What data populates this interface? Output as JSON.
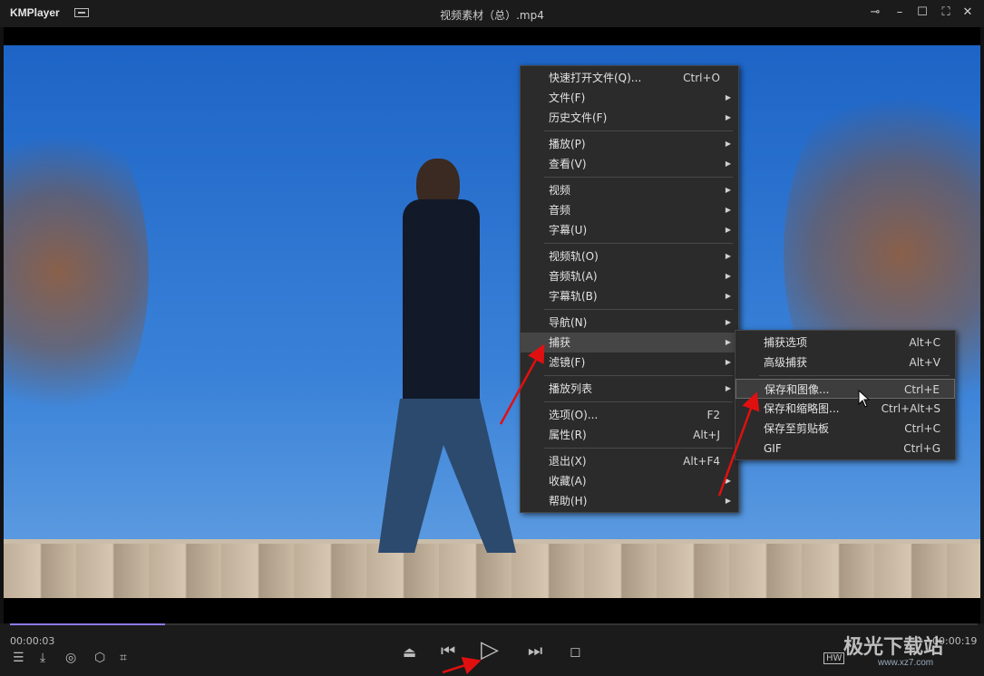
{
  "app": {
    "name": "KMPlayer",
    "title": "视频素材（总）.mp4"
  },
  "window_controls": [
    "pin-icon",
    "minimize-icon",
    "maximize-icon",
    "fullscreen-icon",
    "close-icon"
  ],
  "playback": {
    "current_time": "00:00:03",
    "total_time": "00:00:19",
    "progress_percent": 16
  },
  "main_menu": {
    "groups": [
      [
        {
          "label": "快速打开文件(Q)...",
          "shortcut": "Ctrl+O",
          "submenu": false
        },
        {
          "label": "文件(F)",
          "shortcut": "",
          "submenu": true
        },
        {
          "label": "历史文件(F)",
          "shortcut": "",
          "submenu": true
        }
      ],
      [
        {
          "label": "播放(P)",
          "shortcut": "",
          "submenu": true
        },
        {
          "label": "查看(V)",
          "shortcut": "",
          "submenu": true
        }
      ],
      [
        {
          "label": "视频",
          "shortcut": "",
          "submenu": true
        },
        {
          "label": "音频",
          "shortcut": "",
          "submenu": true
        },
        {
          "label": "字幕(U)",
          "shortcut": "",
          "submenu": true
        }
      ],
      [
        {
          "label": "视频轨(O)",
          "shortcut": "",
          "submenu": true
        },
        {
          "label": "音频轨(A)",
          "shortcut": "",
          "submenu": true
        },
        {
          "label": "字幕轨(B)",
          "shortcut": "",
          "submenu": true
        }
      ],
      [
        {
          "label": "导航(N)",
          "shortcut": "",
          "submenu": true
        },
        {
          "label": "捕获",
          "shortcut": "",
          "submenu": true,
          "highlighted": true
        },
        {
          "label": "滤镜(F)",
          "shortcut": "",
          "submenu": true
        }
      ],
      [
        {
          "label": "播放列表",
          "shortcut": "",
          "submenu": true
        }
      ],
      [
        {
          "label": "选项(O)...",
          "shortcut": "F2",
          "submenu": false
        },
        {
          "label": "属性(R)",
          "shortcut": "Alt+J",
          "submenu": false
        }
      ],
      [
        {
          "label": "退出(X)",
          "shortcut": "Alt+F4",
          "submenu": false
        },
        {
          "label": "收藏(A)",
          "shortcut": "",
          "submenu": true
        },
        {
          "label": "帮助(H)",
          "shortcut": "",
          "submenu": true
        }
      ]
    ]
  },
  "capture_submenu": {
    "groups": [
      [
        {
          "label": "捕获选项",
          "shortcut": "Alt+C"
        },
        {
          "label": "高级捕获",
          "shortcut": "Alt+V"
        }
      ],
      [
        {
          "label": "保存和图像...",
          "shortcut": "Ctrl+E",
          "highlighted": true
        },
        {
          "label": "保存和缩略图...",
          "shortcut": "Ctrl+Alt+S"
        },
        {
          "label": "保存至剪贴板",
          "shortcut": "Ctrl+C"
        },
        {
          "label": "GIF",
          "shortcut": "Ctrl+G"
        }
      ]
    ]
  },
  "watermark": {
    "text": "极光下载站",
    "sub": "www.xz7.com"
  },
  "colors": {
    "accent": "#8a7cf0",
    "annotation_red": "#e01010"
  }
}
